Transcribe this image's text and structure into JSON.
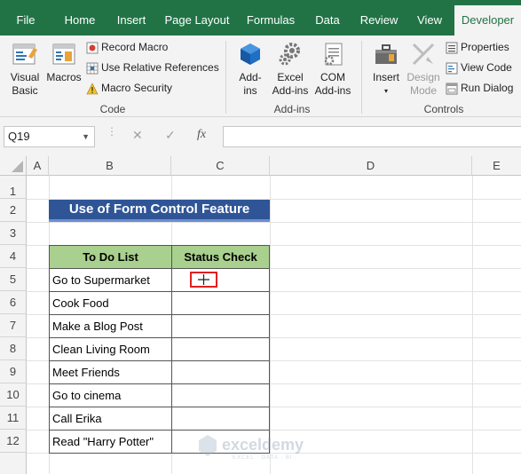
{
  "ribbon_tabs": [
    "File",
    "Home",
    "Insert",
    "Page Layout",
    "Formulas",
    "Data",
    "Review",
    "View",
    "Developer"
  ],
  "active_tab": "Developer",
  "code_group": {
    "visual_basic_line1": "Visual",
    "visual_basic_line2": "Basic",
    "macros": "Macros",
    "record_macro": "Record Macro",
    "use_relative_references": "Use Relative References",
    "macro_security": "Macro Security",
    "label": "Code"
  },
  "addins_group": {
    "addins_line1": "Add-",
    "addins_line2": "ins",
    "excel_addins_line1": "Excel",
    "excel_addins_line2": "Add-ins",
    "com_addins_line1": "COM",
    "com_addins_line2": "Add-ins",
    "label": "Add-ins"
  },
  "controls_group": {
    "insert": "Insert",
    "design_mode_line1": "Design",
    "design_mode_line2": "Mode",
    "properties": "Properties",
    "view_code": "View Code",
    "run_dialog": "Run Dialog",
    "label": "Controls"
  },
  "formula_bar": {
    "name_box": "Q19",
    "fx": "fx",
    "cancel": "✕",
    "enter": "✓",
    "formula": ""
  },
  "columns": [
    "A",
    "B",
    "C",
    "D",
    "E"
  ],
  "rows": [
    "1",
    "2",
    "3",
    "4",
    "5",
    "6",
    "7",
    "8",
    "9",
    "10",
    "11",
    "12"
  ],
  "sheet": {
    "title": "Use of Form Control Feature",
    "header_todo": "To Do List",
    "header_status": "Status Check",
    "tasks": [
      "Go to Supermarket",
      "Cook Food",
      "Make a Blog Post",
      "Clean Living Room",
      "Meet Friends",
      "Go to cinema",
      "Call Erika",
      "Read \"Harry Potter\""
    ]
  },
  "colors": {
    "excel_green": "#217346",
    "title_fill": "#2f5597",
    "header_fill": "#a9d08e",
    "selection_red": "#e02020"
  }
}
